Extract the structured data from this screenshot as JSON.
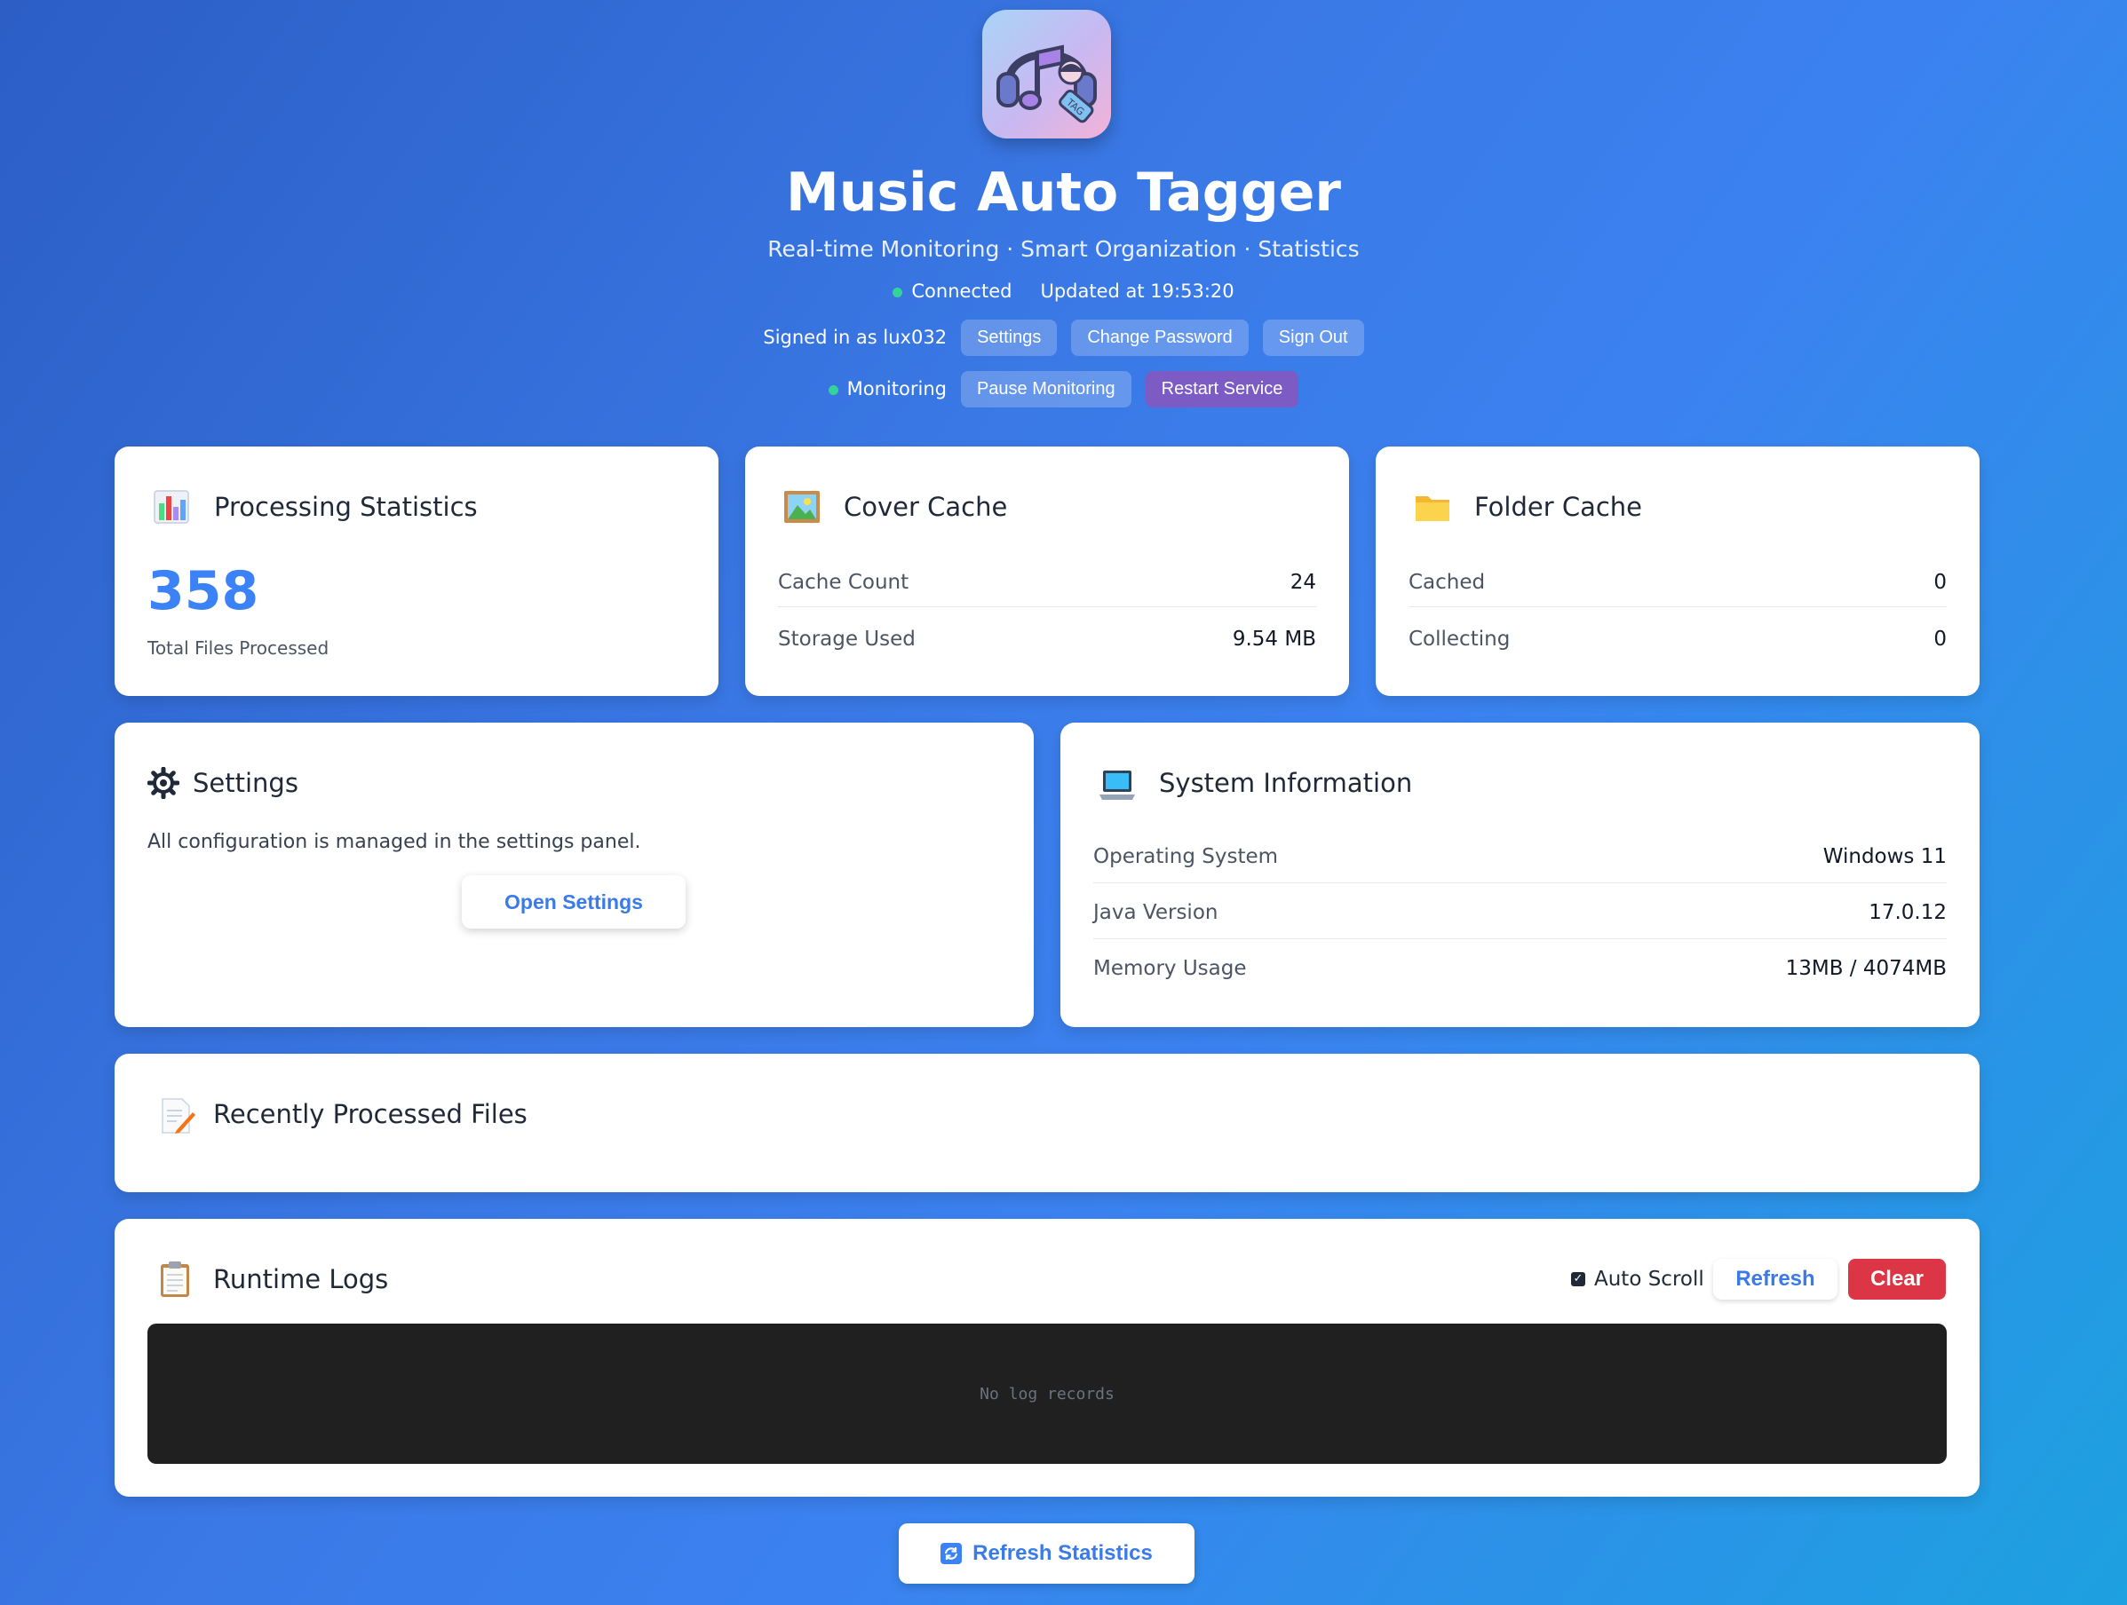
{
  "header": {
    "title": "Music Auto Tagger",
    "subtitle": "Real-time Monitoring · Smart Organization · Statistics",
    "logo_tag_text": "TAG",
    "connection_status": "Connected",
    "updated_at": "Updated at 19:53:20",
    "signed_in_text": "Signed in as lux032",
    "buttons": {
      "settings": "Settings",
      "change_password": "Change Password",
      "sign_out": "Sign Out",
      "pause_monitoring": "Pause Monitoring",
      "restart_service": "Restart Service"
    },
    "monitoring_status": "Monitoring"
  },
  "processing": {
    "title": "Processing Statistics",
    "icon": "bar-chart-icon",
    "total": "358",
    "total_label": "Total Files Processed"
  },
  "cover_cache": {
    "title": "Cover Cache",
    "icon": "picture-icon",
    "rows": [
      {
        "label": "Cache Count",
        "value": "24"
      },
      {
        "label": "Storage Used",
        "value": "9.54 MB"
      }
    ]
  },
  "folder_cache": {
    "title": "Folder Cache",
    "icon": "folder-icon",
    "rows": [
      {
        "label": "Cached",
        "value": "0"
      },
      {
        "label": "Collecting",
        "value": "0"
      }
    ]
  },
  "settings_card": {
    "title": "Settings",
    "icon": "gear-icon",
    "description": "All configuration is managed in the settings panel.",
    "button": "Open Settings"
  },
  "system_info": {
    "title": "System Information",
    "icon": "laptop-icon",
    "rows": [
      {
        "label": "Operating System",
        "value": "Windows 11"
      },
      {
        "label": "Java Version",
        "value": "17.0.12"
      },
      {
        "label": "Memory Usage",
        "value": "13MB / 4074MB"
      }
    ]
  },
  "recent_files": {
    "title": "Recently Processed Files",
    "icon": "memo-icon"
  },
  "runtime_logs": {
    "title": "Runtime Logs",
    "icon": "clipboard-icon",
    "auto_scroll": "Auto Scroll",
    "auto_scroll_checked": true,
    "refresh": "Refresh",
    "clear": "Clear",
    "empty_text": "No log records"
  },
  "footer": {
    "refresh_statistics": "Refresh Statistics",
    "icon": "refresh-icon"
  },
  "colors": {
    "accent": "#3b82f6",
    "status_green": "#34d399",
    "danger": "#dc3545",
    "restart_purple": "#7c5cc4"
  }
}
